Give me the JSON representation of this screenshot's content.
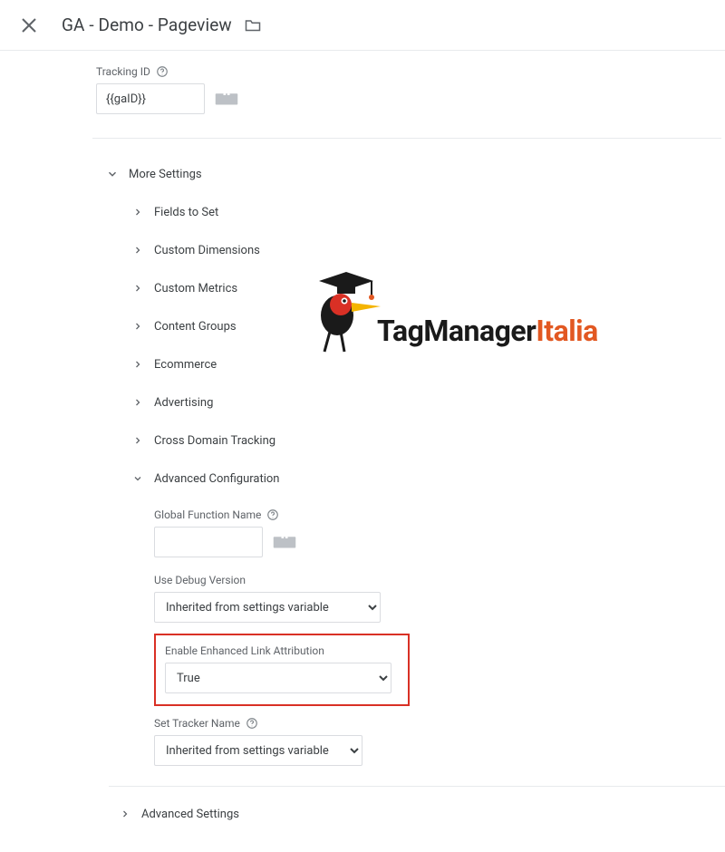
{
  "header": {
    "title": "GA - Demo - Pageview"
  },
  "tracking": {
    "label": "Tracking ID",
    "value": "{{gaID}}"
  },
  "more": {
    "label": "More Settings",
    "items": [
      "Fields to Set",
      "Custom Dimensions",
      "Custom Metrics",
      "Content Groups",
      "Ecommerce",
      "Advertising",
      "Cross Domain Tracking"
    ],
    "adv": {
      "label": "Advanced Configuration",
      "global_fn_label": "Global Function Name",
      "global_fn_value": "",
      "use_debug_label": "Use Debug Version",
      "use_debug_value": "Inherited from settings variable",
      "enhanced_link_label": "Enable Enhanced Link Attribution",
      "enhanced_link_value": "True",
      "set_tracker_label": "Set Tracker Name",
      "set_tracker_value": "Inherited from settings variable"
    }
  },
  "advanced_settings": {
    "label": "Advanced Settings"
  },
  "watermark": {
    "part1": "TagManager",
    "part2": "Italia"
  }
}
